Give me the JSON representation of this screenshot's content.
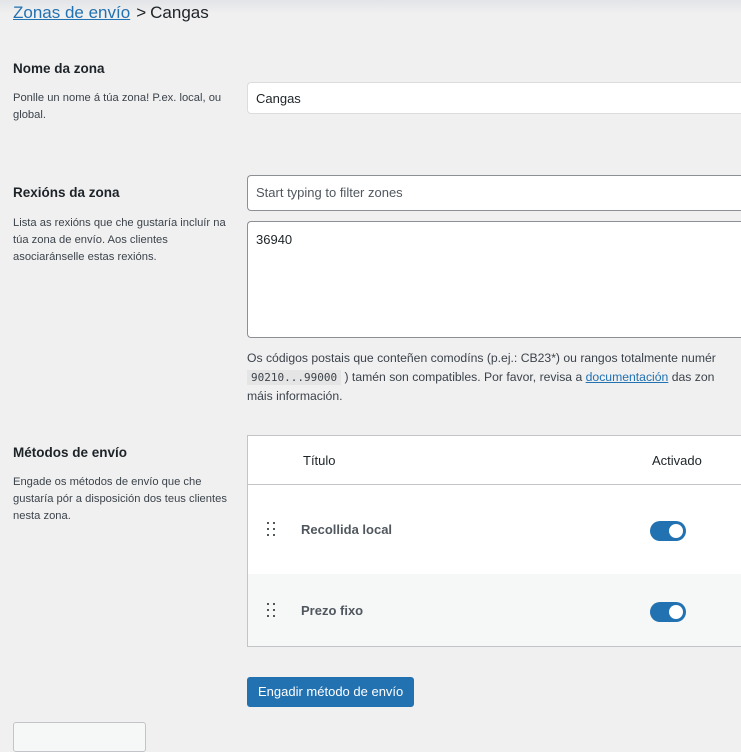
{
  "breadcrumb": {
    "parent": "Zonas de envío",
    "separator": ">",
    "current": "Cangas"
  },
  "zone_name": {
    "label": "Nome da zona",
    "description": "Ponlle un nome á túa zona! P.ex. local, ou global.",
    "value": "Cangas"
  },
  "zone_regions": {
    "label": "Rexións da zona",
    "description": "Lista as rexións que che gustaría incluír na túa zona de envío. Aos clientes asociaránselle estas rexións.",
    "filter_placeholder": "Start typing to filter zones",
    "postcodes": "36940",
    "help_line1": "Os códigos postais que conteñen comodíns (p.ej.: CB23*) ou rangos totalmente numér",
    "help_code": "90210...99000",
    "help_line2_mid": ") tamén son compatibles. Por favor, revisa a",
    "help_link": "documentación",
    "help_line2_end": "das zon",
    "help_line3": "máis información."
  },
  "shipping_methods": {
    "label": "Métodos de envío",
    "description": "Engade os métodos de envío que che gustaría pór a disposición dos teus clientes nesta zona.",
    "columns": {
      "title": "Título",
      "enabled": "Activado"
    },
    "methods": [
      {
        "name": "Recollida local",
        "enabled": true
      },
      {
        "name": "Prezo fixo",
        "enabled": true
      }
    ],
    "add_button": "Engadir método de envío"
  },
  "colors": {
    "accent": "#2271b1",
    "background": "#f0f0f1"
  }
}
